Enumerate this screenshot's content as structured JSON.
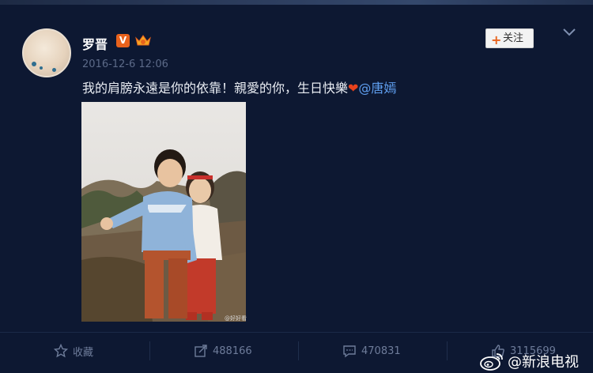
{
  "post": {
    "username": "罗晋",
    "verified_badge": "V",
    "timestamp": "2016-12-6 12:06",
    "text_main": "我的肩膀永遠是你的依靠！親愛的你，生日快樂",
    "heart": "❤",
    "mention": "@唐嫣",
    "photo_watermark": "@好好看"
  },
  "header": {
    "follow_label": "关注",
    "follow_plus": "+"
  },
  "actions": {
    "favorite_label": "收藏",
    "repost_count": "488166",
    "comment_count": "470831",
    "like_count": "3115699"
  },
  "watermark": {
    "brand_text": "@新浪电视"
  },
  "colors": {
    "background": "#0d1832",
    "accent_orange": "#e8621c",
    "mention_blue": "#5f9ff0",
    "muted_text": "#6e7c9a"
  },
  "icons": {
    "favorite": "star-icon",
    "repost": "repost-icon",
    "comment": "comment-icon",
    "like": "thumbs-up-icon",
    "menu": "chevron-down-icon",
    "brand": "weibo-logo-icon"
  }
}
